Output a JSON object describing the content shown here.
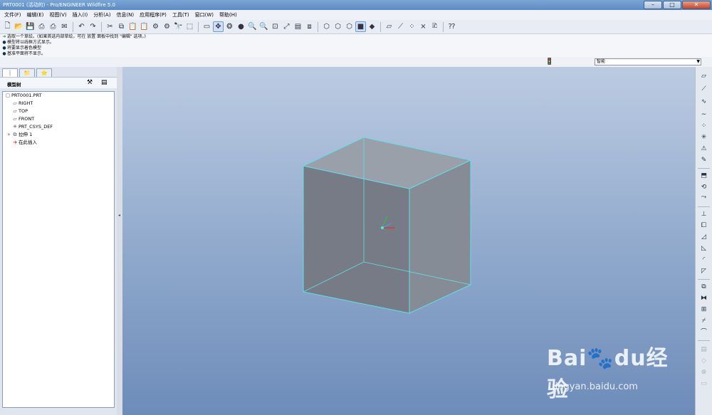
{
  "window": {
    "title": "PRT0001 (活动的) - Pro/ENGINEER Wildfire 5.0",
    "minimize": "–",
    "maximize": "□",
    "close": "✕"
  },
  "menu": [
    "文件(F)",
    "编辑(E)",
    "视图(V)",
    "插入(I)",
    "分析(A)",
    "信息(N)",
    "应用程序(P)",
    "工具(T)",
    "窗口(W)",
    "帮助(H)"
  ],
  "messages": [
    "选取一个草绘。(如果首选内部草绘，可在 放置 面板中找到 \"编辑\" 选项。)",
    "模型将以线框方式显示。",
    "将要显示着色模型",
    "基准平面将不显示。"
  ],
  "filter": {
    "value": "智能",
    "status_icon": "traffic-light-icon"
  },
  "model_tree": {
    "title": "模型树",
    "items": [
      {
        "label": "PRT0001.PRT",
        "icon": "part-icon",
        "expand": ""
      },
      {
        "label": "RIGHT",
        "icon": "datum-plane-icon",
        "expand": ""
      },
      {
        "label": "TOP",
        "icon": "datum-plane-icon",
        "expand": ""
      },
      {
        "label": "FRONT",
        "icon": "datum-plane-icon",
        "expand": ""
      },
      {
        "label": "PRT_CSYS_DEF",
        "icon": "csys-icon",
        "expand": ""
      },
      {
        "label": "拉伸 1",
        "icon": "extrude-icon",
        "expand": "+"
      },
      {
        "label": "在此插入",
        "icon": "insert-here-icon",
        "expand": ""
      }
    ]
  },
  "watermark": {
    "logo": "Bai🐾du经验",
    "url": "jingyan.baidu.com"
  },
  "colors": {
    "viewport_top": "#bccbe2",
    "viewport_bottom": "#6e8cba",
    "model_edge": "#5fe0e6",
    "model_fill": "#7a808a",
    "csys_x": "#e03030",
    "csys_y": "#30c040",
    "csys_z": "#40a0ff"
  }
}
